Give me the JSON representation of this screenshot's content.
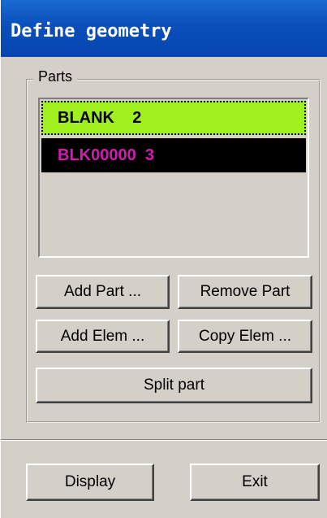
{
  "window": {
    "title": "Define geometry"
  },
  "parts_group": {
    "legend": "Parts",
    "items": [
      {
        "label": "BLANK    2",
        "selected": true,
        "text_color": "#000000",
        "background": "#a0f020"
      },
      {
        "label": "BLK00000  3",
        "selected": false,
        "text_color": "#d21cb0",
        "background": "#000000"
      }
    ],
    "buttons": {
      "add_part": "Add Part ...",
      "remove_part": "Remove Part",
      "add_elem": "Add Elem ...",
      "copy_elem": "Copy Elem ...",
      "split_part": "Split part"
    }
  },
  "footer": {
    "display_label": "Display",
    "exit_label": "Exit"
  },
  "colors": {
    "titlebar": "#0a4fba",
    "window_bg": "#d4d0c8"
  }
}
